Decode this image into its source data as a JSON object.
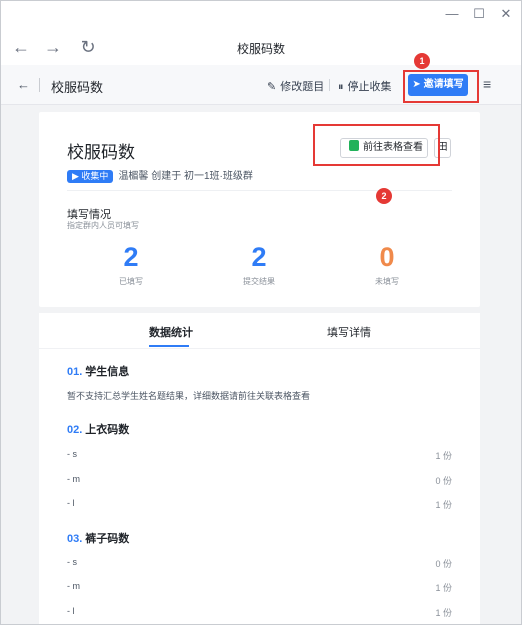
{
  "window": {
    "minimize": "—",
    "maximize": "☐",
    "close": "✕"
  },
  "browser": {
    "back": "←",
    "forward": "→",
    "reload": "↻",
    "title": "校服码数"
  },
  "toolbar": {
    "back": "←",
    "title": "校服码数",
    "edit_label": "修改题目",
    "stop_label": "停止收集",
    "invite_label": "邀请填写",
    "menu": "≡"
  },
  "annotations": [
    "1",
    "2"
  ],
  "card": {
    "title": "校服码数",
    "view_sheet": "前往表格查看",
    "qr": "田",
    "status": "▶ 收集中",
    "meta": "温楣馨 创建于 初一1班·班级群",
    "fill_title": "填写情况",
    "fill_sub": "指定群内人员可填写",
    "stats": [
      {
        "value": "2",
        "label": "已填写",
        "color": "#2f7cf6"
      },
      {
        "value": "2",
        "label": "提交结果",
        "color": "#2f7cf6"
      },
      {
        "value": "0",
        "label": "未填写",
        "color": "#f08a4b"
      }
    ]
  },
  "panel": {
    "tabs": [
      "数据统计",
      "填写详情"
    ],
    "questions": [
      {
        "num": "01.",
        "title": "学生信息",
        "note": "暂不支持汇总学生姓名题结果，详细数据请前往关联表格查看",
        "options": []
      },
      {
        "num": "02.",
        "title": "上衣码数",
        "options": [
          {
            "label": "- s",
            "count": "1 份"
          },
          {
            "label": "- m",
            "count": "0 份"
          },
          {
            "label": "- l",
            "count": "1 份"
          }
        ]
      },
      {
        "num": "03.",
        "title": "裤子码数",
        "options": [
          {
            "label": "- s",
            "count": "0 份"
          },
          {
            "label": "- m",
            "count": "1 份"
          },
          {
            "label": "- l",
            "count": "1 份"
          }
        ]
      }
    ]
  }
}
